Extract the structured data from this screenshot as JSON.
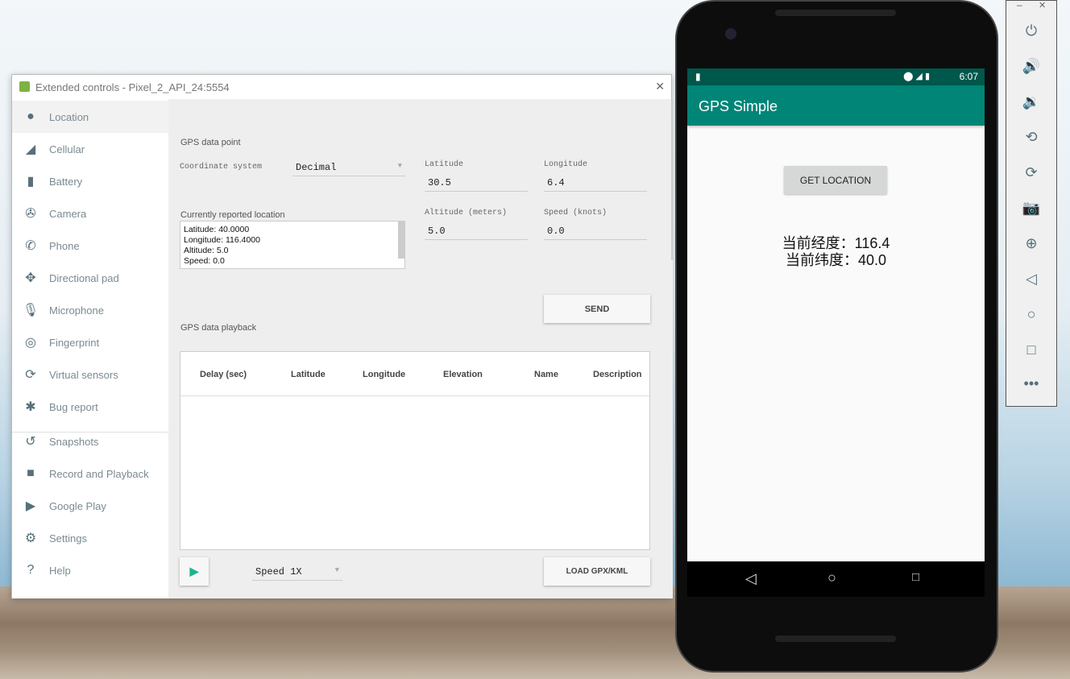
{
  "dialog": {
    "title": "Extended controls - Pixel_2_API_24:5554",
    "close": "✕"
  },
  "sidebar": {
    "items": [
      {
        "label": "Location",
        "icon": "●"
      },
      {
        "label": "Cellular",
        "icon": "◢"
      },
      {
        "label": "Battery",
        "icon": "▮"
      },
      {
        "label": "Camera",
        "icon": "✇"
      },
      {
        "label": "Phone",
        "icon": "✆"
      },
      {
        "label": "Directional pad",
        "icon": "✥"
      },
      {
        "label": "Microphone",
        "icon": "🎙"
      },
      {
        "label": "Fingerprint",
        "icon": "◎"
      },
      {
        "label": "Virtual sensors",
        "icon": "⟳"
      },
      {
        "label": "Bug report",
        "icon": "✱"
      },
      {
        "label": "Snapshots",
        "icon": "↺"
      },
      {
        "label": "Record and Playback",
        "icon": "■"
      },
      {
        "label": "Google Play",
        "icon": "▶"
      },
      {
        "label": "Settings",
        "icon": "⚙"
      },
      {
        "label": "Help",
        "icon": "?"
      }
    ]
  },
  "gps": {
    "section": "GPS data point",
    "coord_label": "Coordinate system",
    "coord_value": "Decimal",
    "lat_label": "Latitude",
    "lat_value": "30.5",
    "lon_label": "Longitude",
    "lon_value": "6.4",
    "alt_label": "Altitude (meters)",
    "alt_value": "5.0",
    "speed_label": "Speed (knots)",
    "speed_value": "0.0",
    "reported_label": "Currently reported location",
    "reported": [
      "Latitude: 40.0000",
      "Longitude: 116.4000",
      "Altitude: 5.0",
      "Speed: 0.0"
    ],
    "send": "SEND"
  },
  "playback": {
    "section": "GPS data playback",
    "columns": [
      "Delay (sec)",
      "Latitude",
      "Longitude",
      "Elevation",
      "Name",
      "Description"
    ],
    "speed": "Speed 1X",
    "load": "LOAD GPX/KML"
  },
  "phone": {
    "time": "6:07",
    "app_title": "GPS Simple",
    "button": "GET LOCATION",
    "line1": "当前经度：116.4",
    "line2": "当前纬度：40.0"
  },
  "toolbar": {
    "minimize": "–",
    "close": "✕"
  }
}
